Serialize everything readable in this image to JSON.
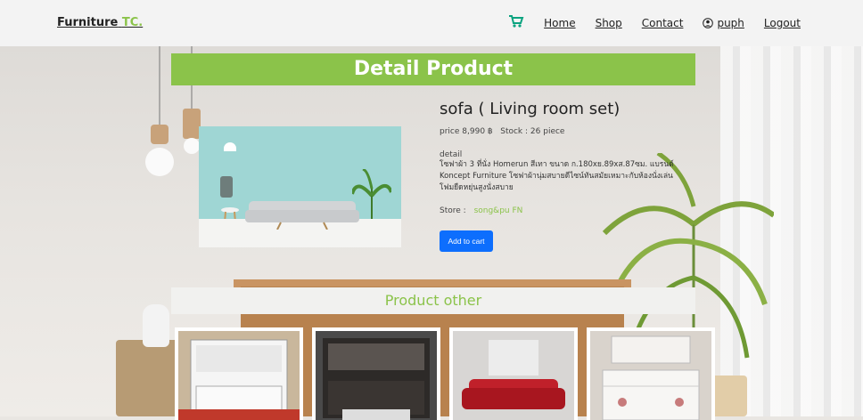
{
  "navbar": {
    "brand_main": "Furniture",
    "brand_accent": "TC.",
    "links": {
      "home": "Home",
      "shop": "Shop",
      "contact": "Contact",
      "user": "puph",
      "logout": "Logout"
    }
  },
  "page": {
    "detail_title": "Detail Product",
    "other_title": "Product other"
  },
  "product": {
    "name": "sofa ( Living room set)",
    "price_label": "price",
    "price": "8,990 ฿",
    "stock_label": "Stock :",
    "stock": "26 piece",
    "detail_label": "detail",
    "detail_text": "โซฟาผ้า 3 ที่นั่ง Homerun สีเทา ขนาด ก.180xย.89xส.87ซม. แบรนด์ Koncept Furniture โซฟาผ้านุ่มสบายดีไซน์ทันสมัยเหมาะกับห้องนั่งเล่น โฟมยืดหยุ่นสูงนั่งสบาย",
    "store_label": "Store :",
    "store_name": "song&pu FN",
    "add_to_cart": "Add to cart"
  },
  "other_products": [
    {
      "name": "kitchen-cabinet-white"
    },
    {
      "name": "kitchen-cabinet-black"
    },
    {
      "name": "red-sofa"
    },
    {
      "name": "white-dresser"
    }
  ],
  "colors": {
    "accent": "#8bc34a",
    "button": "#0d6efd"
  }
}
